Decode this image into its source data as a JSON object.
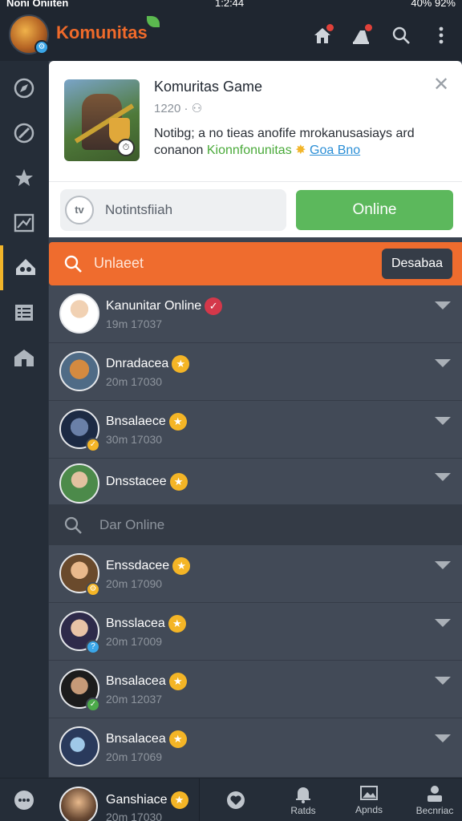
{
  "status_bar": {
    "carrier": "Noni Oniiten",
    "time": "1:2:44",
    "right": "40% 92%"
  },
  "header": {
    "title": "Komunitas",
    "icons": [
      "home-icon",
      "notification-icon",
      "search-icon",
      "more-icon"
    ]
  },
  "sidebar": {
    "items": [
      {
        "icon": "compass-icon",
        "active": false
      },
      {
        "icon": "explore-icon",
        "active": false
      },
      {
        "icon": "star-icon",
        "active": false
      },
      {
        "icon": "map-icon",
        "active": false
      },
      {
        "icon": "group-icon",
        "active": true
      },
      {
        "icon": "list-icon",
        "active": false
      },
      {
        "icon": "building-icon",
        "active": false
      }
    ]
  },
  "game_card": {
    "title": "Komuritas Game",
    "count": "1220",
    "desc_prefix": "Notibg; a no tieas anofife mrokanusasiays ard conanon",
    "link1": "Kionnfonunitas",
    "link2": "Goa Bno",
    "status_text": "Notintsfiiah",
    "status_icon_text": "tv",
    "online_label": "Online"
  },
  "search": {
    "text": "Unlaeet",
    "button": "Desabaa"
  },
  "list": [
    {
      "name": "Kanunitar Online",
      "sub": "19m 17037",
      "badge": "heart"
    },
    {
      "name": "Dnradacea",
      "sub": "20m 17030",
      "badge": "star"
    },
    {
      "name": "Bnsalaece",
      "sub": "30m 17030",
      "badge": "star"
    },
    {
      "name": "Dnsstacee",
      "sub": "",
      "badge": "star"
    }
  ],
  "subsearch": {
    "text": "Dar Online"
  },
  "list2": [
    {
      "name": "Enssdacee",
      "sub": "20m 17090",
      "badge": "star"
    },
    {
      "name": "Bnsslacea",
      "sub": "20m 17009",
      "badge": "star"
    },
    {
      "name": "Bnsalacea",
      "sub": "20m 12037",
      "badge": "star"
    },
    {
      "name": "Bnsalacea",
      "sub": "20m 17069",
      "badge": "star"
    }
  ],
  "bottom": {
    "row_name": "Ganshiace",
    "row_sub": "20m 17030",
    "nav": [
      {
        "label": "",
        "icon": "chat-icon"
      },
      {
        "label": "Ratds",
        "icon": "bell-icon"
      },
      {
        "label": "Apnds",
        "icon": "image-icon"
      },
      {
        "label": "Becnriac",
        "icon": "profile-icon"
      }
    ]
  },
  "colors": {
    "accent_orange": "#ef6c2e",
    "online_green": "#5cb85c",
    "star_yellow": "#f4b526"
  }
}
